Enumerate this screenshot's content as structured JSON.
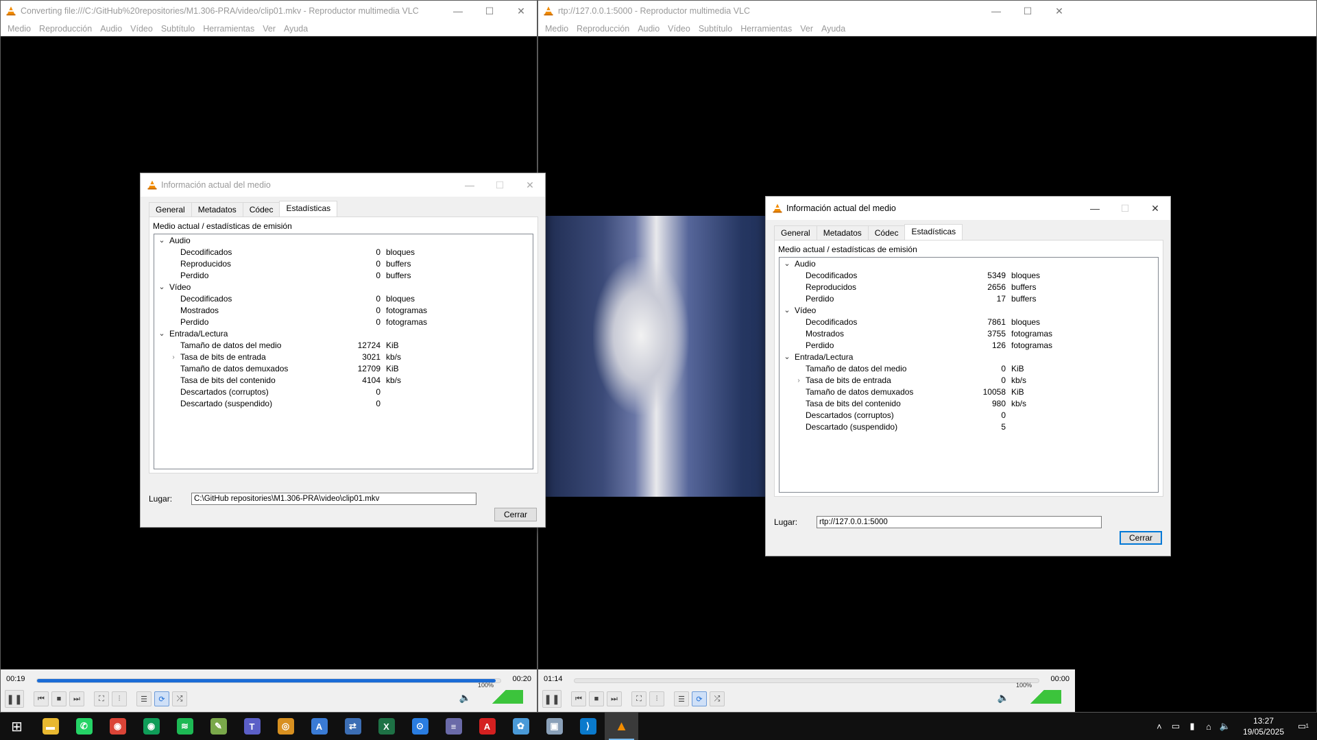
{
  "colors": {
    "vlc_orange": "#f28c00",
    "accent": "#1b6cd6",
    "volume": "#3cc43c"
  },
  "left_window": {
    "title": "Converting file:///C:/GitHub%20repositories/M1.306-PRA/video/clip01.mkv - Reproductor multimedia VLC",
    "controls": {
      "minimize": "—",
      "maximize": "☐",
      "close": "✕"
    },
    "menu": [
      "Medio",
      "Reproducción",
      "Audio",
      "Vídeo",
      "Subtítulo",
      "Herramientas",
      "Ver",
      "Ayuda"
    ],
    "time_elapsed": "00:19",
    "time_total": "00:20",
    "progress": 0.99,
    "volume_label": "100%",
    "volume": 1.0
  },
  "right_window": {
    "title": "rtp://127.0.0.1:5000 - Reproductor multimedia VLC",
    "controls": {
      "minimize": "—",
      "maximize": "☐",
      "close": "✕"
    },
    "menu": [
      "Medio",
      "Reproducción",
      "Audio",
      "Vídeo",
      "Subtítulo",
      "Herramientas",
      "Ver",
      "Ayuda"
    ],
    "time_elapsed": "01:14",
    "time_total": "00:00",
    "progress": 0,
    "volume_label": "100%",
    "volume": 1.0
  },
  "left_dialog": {
    "title": "Información actual del medio",
    "tabs": [
      "General",
      "Metadatos",
      "Códec",
      "Estadísticas"
    ],
    "caption": "Medio actual / estadísticas de emisión",
    "audio": {
      "label": "Audio",
      "rows": [
        {
          "name": "Decodificados",
          "value": "0",
          "unit": "bloques"
        },
        {
          "name": "Reproducidos",
          "value": "0",
          "unit": "buffers"
        },
        {
          "name": "Perdido",
          "value": "0",
          "unit": "buffers"
        }
      ]
    },
    "video": {
      "label": "Vídeo",
      "rows": [
        {
          "name": "Decodificados",
          "value": "0",
          "unit": "bloques"
        },
        {
          "name": "Mostrados",
          "value": "0",
          "unit": "fotogramas"
        },
        {
          "name": "Perdido",
          "value": "0",
          "unit": "fotogramas"
        }
      ]
    },
    "io": {
      "label": "Entrada/Lectura",
      "rows": [
        {
          "name": "Tamaño de datos del medio",
          "value": "12724",
          "unit": "KiB"
        },
        {
          "name": "Tasa de bits de entrada",
          "value": "3021",
          "unit": "kb/s"
        },
        {
          "name": "Tamaño de datos demuxados",
          "value": "12709",
          "unit": "KiB"
        },
        {
          "name": "Tasa de bits del contenido",
          "value": "4104",
          "unit": "kb/s"
        },
        {
          "name": "Descartados (corruptos)",
          "value": "0",
          "unit": ""
        },
        {
          "name": "Descartado (suspendido)",
          "value": "0",
          "unit": ""
        }
      ]
    },
    "lugar_label": "Lugar:",
    "lugar_value": "C:\\GitHub repositories\\M1.306-PRA\\video\\clip01.mkv",
    "close_label": "Cerrar"
  },
  "right_dialog": {
    "title": "Información actual del medio",
    "tabs": [
      "General",
      "Metadatos",
      "Códec",
      "Estadísticas"
    ],
    "caption": "Medio actual / estadísticas de emisión",
    "audio": {
      "label": "Audio",
      "rows": [
        {
          "name": "Decodificados",
          "value": "5349",
          "unit": "bloques"
        },
        {
          "name": "Reproducidos",
          "value": "2656",
          "unit": "buffers"
        },
        {
          "name": "Perdido",
          "value": "17",
          "unit": "buffers"
        }
      ]
    },
    "video": {
      "label": "Vídeo",
      "rows": [
        {
          "name": "Decodificados",
          "value": "7861",
          "unit": "bloques"
        },
        {
          "name": "Mostrados",
          "value": "3755",
          "unit": "fotogramas"
        },
        {
          "name": "Perdido",
          "value": "126",
          "unit": "fotogramas"
        }
      ]
    },
    "io": {
      "label": "Entrada/Lectura",
      "rows": [
        {
          "name": "Tamaño de datos del medio",
          "value": "0",
          "unit": "KiB"
        },
        {
          "name": "Tasa de bits de entrada",
          "value": "0",
          "unit": "kb/s"
        },
        {
          "name": "Tamaño de datos demuxados",
          "value": "10058",
          "unit": "KiB"
        },
        {
          "name": "Tasa de bits del contenido",
          "value": "980",
          "unit": "kb/s"
        },
        {
          "name": "Descartados (corruptos)",
          "value": "0",
          "unit": ""
        },
        {
          "name": "Descartado (suspendido)",
          "value": "5",
          "unit": ""
        }
      ]
    },
    "lugar_label": "Lugar:",
    "lugar_value": "rtp://127.0.0.1:5000",
    "close_label": "Cerrar"
  },
  "taskbar": {
    "apps": [
      {
        "name": "windows-start-icon",
        "glyph": "⊞",
        "color": "#101010"
      },
      {
        "name": "file-explorer-icon",
        "glyph": "▬",
        "color": "#e8b830"
      },
      {
        "name": "whatsapp-icon",
        "glyph": "✆",
        "color": "#25d366"
      },
      {
        "name": "chrome-icon",
        "glyph": "◉",
        "color": "#db4437"
      },
      {
        "name": "chrome-profile-icon",
        "glyph": "◉",
        "color": "#0f9d58"
      },
      {
        "name": "spotify-icon",
        "glyph": "≋",
        "color": "#1db954"
      },
      {
        "name": "notepad-icon",
        "glyph": "✎",
        "color": "#7aa84a"
      },
      {
        "name": "teams-icon",
        "glyph": "T",
        "color": "#5b5fc7"
      },
      {
        "name": "app-orange-icon",
        "glyph": "◎",
        "color": "#d89020"
      },
      {
        "name": "app-store-icon",
        "glyph": "A",
        "color": "#3a7bd5"
      },
      {
        "name": "network-app-icon",
        "glyph": "⇄",
        "color": "#3c6eb4"
      },
      {
        "name": "excel-icon",
        "glyph": "X",
        "color": "#1e7145"
      },
      {
        "name": "remote-app-icon",
        "glyph": "⊙",
        "color": "#2a7de1"
      },
      {
        "name": "drive-icon",
        "glyph": "≡",
        "color": "#6a6aa8"
      },
      {
        "name": "acrobat-icon",
        "glyph": "A",
        "color": "#d42020"
      },
      {
        "name": "paint-icon",
        "glyph": "✿",
        "color": "#4a9ad8"
      },
      {
        "name": "screen-app-icon",
        "glyph": "▣",
        "color": "#8aa0b8"
      },
      {
        "name": "vscode-icon",
        "glyph": "⟩",
        "color": "#0a7acc"
      },
      {
        "name": "vlc-icon",
        "glyph": "▲",
        "color": "#f28c00"
      }
    ],
    "time": "13:27",
    "date": "19/05/2025",
    "notifications": "1"
  }
}
